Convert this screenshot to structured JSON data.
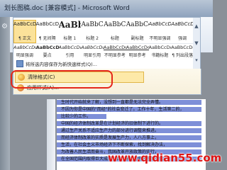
{
  "window": {
    "title": "划长图稿.doc [兼容模式] - Microsoft Word"
  },
  "gallery": {
    "row1": [
      {
        "sample": "AaBbCcDd",
        "name": "¶ 正文",
        "size": "small"
      },
      {
        "sample": "AaBbCcDd",
        "name": "¶ 无间隔",
        "size": "small"
      },
      {
        "sample": "AaBb",
        "name": "标题 1",
        "size": "big"
      },
      {
        "sample": "AaBbC",
        "name": "标题 2",
        "size": "mid"
      },
      {
        "sample": "AaBbC",
        "name": "标题",
        "size": "mid"
      },
      {
        "sample": "AaBbCc",
        "name": "副标题",
        "size": "mid"
      },
      {
        "sample": "AaBbCcDd",
        "name": "不明显强调",
        "size": "small",
        "style": "italic"
      },
      {
        "sample": "AaBbCcDd",
        "name": "强调",
        "size": "small",
        "style": "italic"
      }
    ],
    "row2": [
      {
        "sample": "AaBbCcDd",
        "name": "明显强调"
      },
      {
        "sample": "AaBbCcDd",
        "name": "要点"
      },
      {
        "sample": "AaBbCcDd",
        "name": "引用"
      },
      {
        "sample": "AaBbCcDd",
        "name": "明显引用"
      },
      {
        "sample": "AaBbCcDd",
        "name": "不明显参考"
      },
      {
        "sample": "AaBbCcDd",
        "name": "明显参考"
      },
      {
        "sample": "AaBbCcDd",
        "name": "书籍标题"
      },
      {
        "sample": "AaBbCcDd",
        "name": "¶ 列出段落"
      }
    ]
  },
  "commands": {
    "save_selection": "将所选内容保存为新快速样式(Q)...",
    "clear_format": "清除格式(C)",
    "apply_styles": "应用样式(A)..."
  },
  "document": {
    "lines": [
      "生时代开始就来了解，没想到一直都是无法完全弄懂。",
      "不因为你是中国的\"而经\"的社会变迁了。工作十年，生活第二的，",
      "比较少的工作。",
      "中国的经济体制改革是在计划经济的旧体制下进行的。",
      "通过生产关系不适应生产力的部分进行调整来推进。",
      "而经济体制改革的实质是发展生产力，人八方事上，",
      "生活，在社会主义市场经济下不断探索，找到解决办法，",
      "为改善人民生活而奋斗，我国改革开放政策的实行，",
      "在全国范围内取得巨大成就，百年来的历史进程的变化。"
    ]
  },
  "watermark": "www.qidian55.com"
}
